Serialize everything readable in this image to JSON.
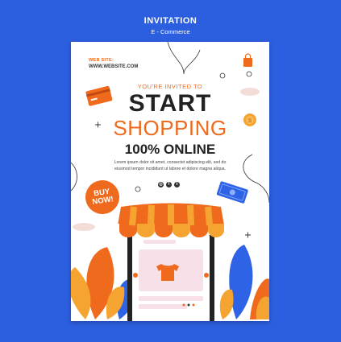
{
  "header": {
    "title": "INVITATION",
    "subtitle": "E - Commerce"
  },
  "flyer": {
    "website_label": "WEB SITE:",
    "website_url": "WWW.WEBSITE.COM",
    "invited": "YOU'RE INVITED TO",
    "line1": "START",
    "line2": "SHOPPING",
    "line3": "100% ONLINE",
    "body": "Lorem ipsum dolor sit amet, consectet adipiscing elit, sed do eiusmod tempor incididunt ut labore et dolore magna aliqua.",
    "social": [
      "instagram-icon",
      "facebook-icon",
      "twitter-icon"
    ],
    "buy_line1": "BUY",
    "buy_line2": "NOW!"
  },
  "colors": {
    "background": "#2c5fe0",
    "accent": "#f06a1d",
    "blue": "#2f63e6",
    "text": "#222222"
  }
}
